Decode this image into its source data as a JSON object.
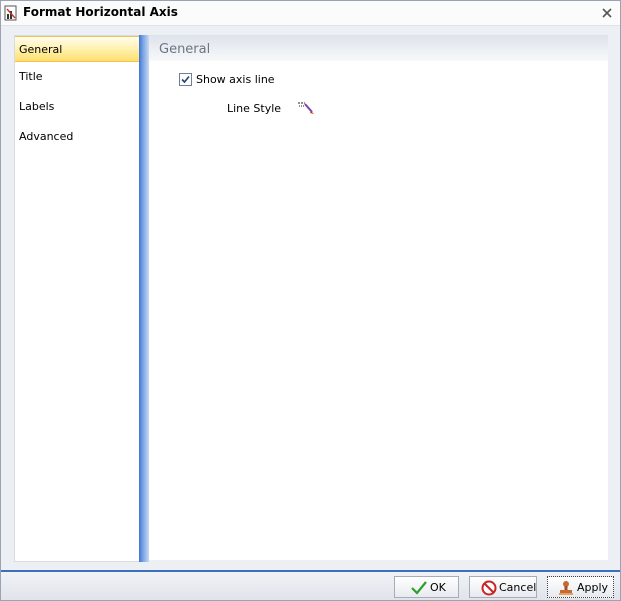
{
  "window": {
    "title": "Format Horizontal Axis",
    "icon": "axis-format-icon",
    "close_icon": "close-icon"
  },
  "nav": {
    "items": [
      {
        "label": "General",
        "active": true
      },
      {
        "label": "Title",
        "active": false
      },
      {
        "label": "Labels",
        "active": false
      },
      {
        "label": "Advanced",
        "active": false
      }
    ]
  },
  "panel": {
    "title": "General",
    "show_axis_line": {
      "label": "Show axis line",
      "checked": true
    },
    "line_style": {
      "label": "Line Style",
      "icon": "line-style-icon"
    }
  },
  "footer": {
    "ok_label": "OK",
    "cancel_label": "Cancel",
    "apply_label": "Apply"
  },
  "colors": {
    "accent": "#3d6fbf",
    "active_tab": "#ffe27a",
    "ok_green": "#2e9e2e",
    "cancel_red": "#cc2222"
  }
}
